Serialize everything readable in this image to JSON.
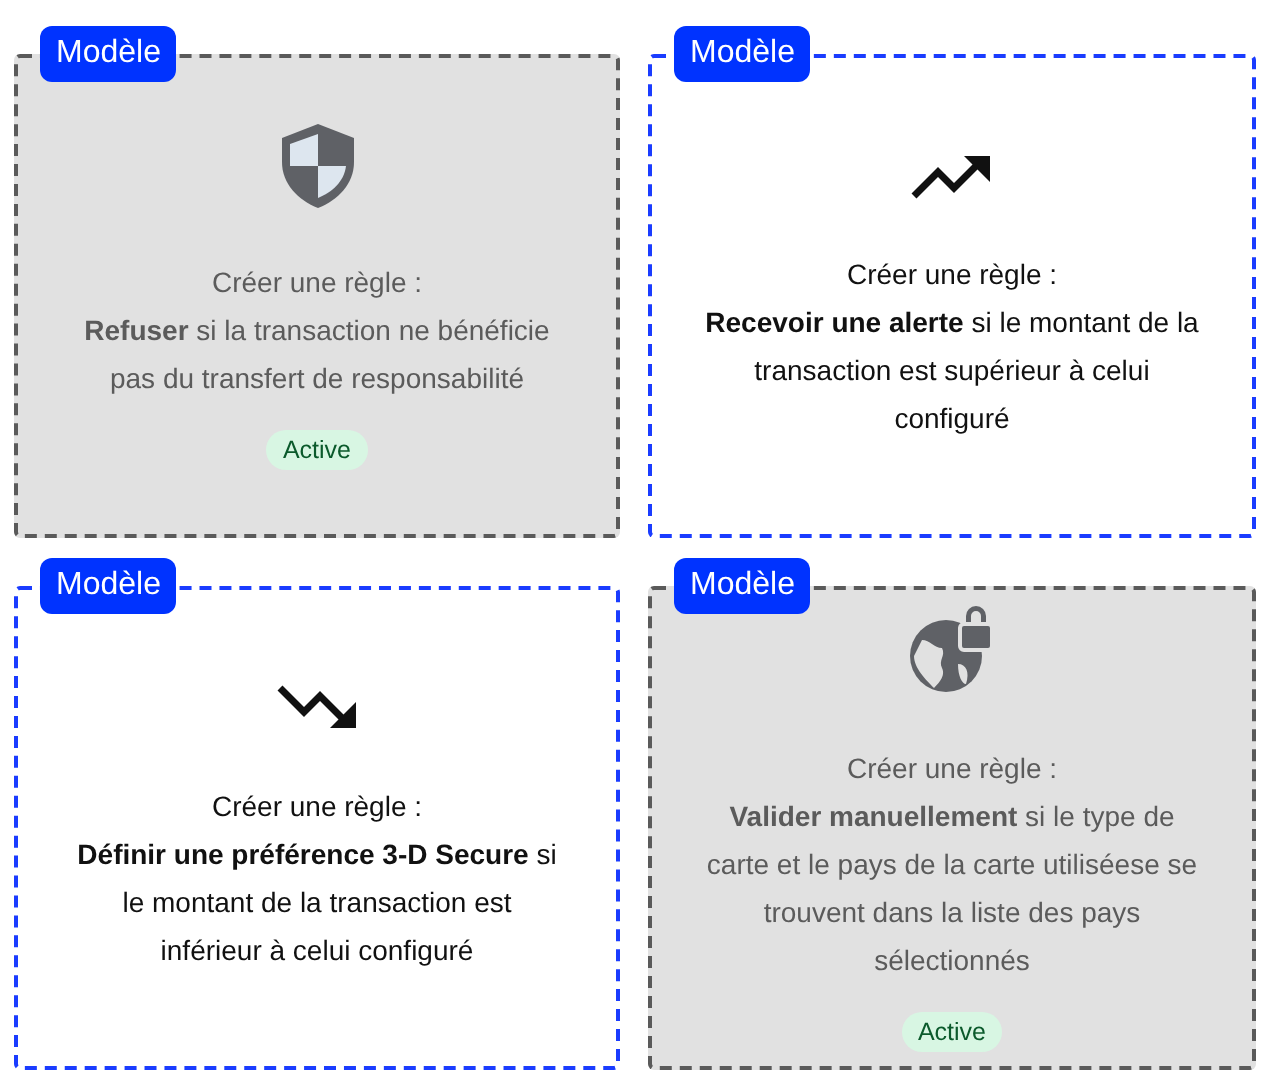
{
  "cards": [
    {
      "tag": "Modèle",
      "kind": "shield",
      "active": true,
      "title": "Créer une règle :",
      "description": "**Refuser** si la transaction ne bénéficie pas du transfert de responsabilité",
      "status": "Active"
    },
    {
      "tag": "Modèle",
      "kind": "trend-up",
      "active": false,
      "title": "Créer une règle :",
      "description": "**Recevoir une alerte** si le montant de la transaction est supérieur à celui configuré"
    },
    {
      "tag": "Modèle",
      "kind": "trend-down",
      "active": false,
      "title": "Créer une règle :",
      "description": "**Définir une préférence 3-D Secure** si le montant de la transaction est inférieur à celui configuré"
    },
    {
      "tag": "Modèle",
      "kind": "globe-lock",
      "active": true,
      "title": "Créer une règle :",
      "description": "**Valider manuellement** si le type de carte et le pays de la carte utiliséese se trouvent dans la liste des pays sélectionnés",
      "status": "Active"
    }
  ]
}
